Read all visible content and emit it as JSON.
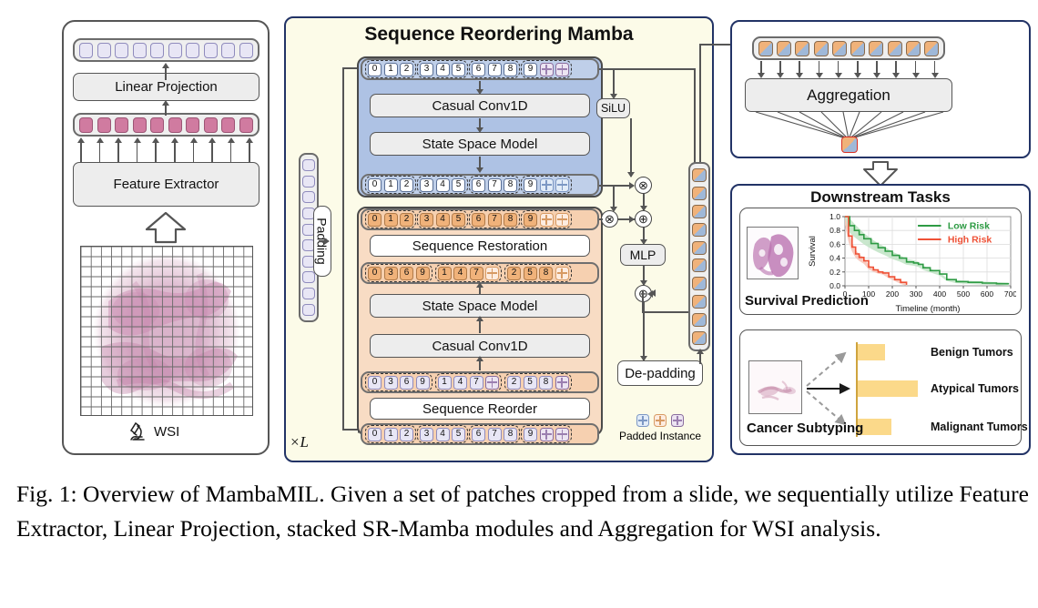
{
  "figure": {
    "caption": "Fig. 1: Overview of MambaMIL. Given a set of patches cropped from a slide, we sequentially utilize Feature Extractor, Linear Projection, stacked SR-Mamba modules and Aggregation for WSI analysis."
  },
  "left_panel": {
    "linear_projection_label": "Linear Projection",
    "feature_extractor_label": "Feature Extractor",
    "wsi_label": "WSI",
    "wsi_icon": "microscope-icon",
    "projected_token_count": 10,
    "feature_token_count": 10,
    "projected_token_color": "#e8e6f5",
    "feature_token_color": "#d07ba0"
  },
  "center_panel": {
    "title": "Sequence Reordering Mamba",
    "padding_label": "Padding",
    "repeat_label": "×L",
    "padding_column_tiles": 10,
    "padding_column_color": "#e8e6f5",
    "output_column_tiles": 10,
    "legend": {
      "label": "Padded Instance",
      "variants": [
        "blue",
        "orange",
        "purple"
      ]
    },
    "blue_branch": {
      "background": "#aec2e4",
      "input_sequence": {
        "groups": [
          [
            "0",
            "1",
            "2"
          ],
          [
            "3",
            "4",
            "5"
          ],
          [
            "6",
            "7",
            "8"
          ],
          [
            "9",
            "pad",
            "pad"
          ]
        ],
        "pad_style": "purple",
        "strip_color": "#bfcfe9"
      },
      "blocks": [
        "Casual Conv1D",
        "State Space Model"
      ],
      "output_sequence": {
        "groups": [
          [
            "0",
            "1",
            "2"
          ],
          [
            "3",
            "4",
            "5"
          ],
          [
            "6",
            "7",
            "8"
          ],
          [
            "9",
            "pad",
            "pad"
          ]
        ],
        "pad_style": "blue",
        "strip_color": "#bfcfe9"
      }
    },
    "orange_branch": {
      "background": "#f8dcc4",
      "top_sequence": {
        "groups": [
          [
            "0",
            "1",
            "2"
          ],
          [
            "3",
            "4",
            "5"
          ],
          [
            "6",
            "7",
            "8"
          ],
          [
            "9",
            "pad",
            "pad"
          ]
        ],
        "pad_style": "orange",
        "cell_color": "#f0b27a"
      },
      "sequence_restoration_label": "Sequence Restoration",
      "restored_sequence": {
        "groups": [
          [
            "0",
            "3",
            "6",
            "9"
          ],
          [
            "1",
            "4",
            "7",
            "pad"
          ],
          [
            "2",
            "5",
            "8",
            "pad"
          ]
        ],
        "pad_style": "orange",
        "cell_color": "#f0b27a"
      },
      "blocks": [
        "State Space Model",
        "Casual Conv1D"
      ],
      "reordered_sequence": {
        "groups": [
          [
            "0",
            "3",
            "6",
            "9"
          ],
          [
            "1",
            "4",
            "7",
            "pad"
          ],
          [
            "2",
            "5",
            "8",
            "pad"
          ]
        ],
        "pad_style": "purple",
        "cell_color": "#e8e6f5"
      },
      "sequence_reorder_label": "Sequence Reorder",
      "bottom_sequence": {
        "groups": [
          [
            "0",
            "1",
            "2"
          ],
          [
            "3",
            "4",
            "5"
          ],
          [
            "6",
            "7",
            "8"
          ],
          [
            "9",
            "pad",
            "pad"
          ]
        ],
        "pad_style": "purple",
        "cell_color": "#e8e6f5"
      }
    },
    "operators": {
      "silu_label": "SiLU",
      "mlp_label": "MLP",
      "depadding_label": "De-padding",
      "multiply_symbol": "⊗",
      "add_symbol": "⊕"
    }
  },
  "aggregation_panel": {
    "title": "Aggregation",
    "input_token_count": 10,
    "output_token_highlight_color": "#d93025"
  },
  "downstream_panel": {
    "title": "Downstream Tasks",
    "survival": {
      "task_label": "Survival Prediction",
      "thumbnail": "tissue-slide-thumbnail"
    },
    "subtyping": {
      "task_label": "Cancer Subtyping",
      "thumbnail": "tissue-slide-thumbnail",
      "classes": [
        "Benign Tumors",
        "Atypical Tumors",
        "Malignant Tumors"
      ],
      "bar_color": "#fbd98a",
      "bar_values": [
        0.18,
        0.62,
        0.26
      ]
    }
  },
  "chart_data": [
    {
      "type": "line",
      "title": "",
      "xlabel": "Timeline (month)",
      "ylabel": "Survival",
      "xlim": [
        0,
        700
      ],
      "ylim": [
        0.0,
        1.0
      ],
      "xticks": [
        0,
        100,
        200,
        300,
        400,
        500,
        600,
        700
      ],
      "yticks": [
        0.0,
        0.2,
        0.4,
        0.6,
        0.8,
        1.0
      ],
      "grid": true,
      "legend_position": "upper right",
      "series": [
        {
          "name": "Low Risk",
          "color": "#2e9b44",
          "band_color": "#bfe3c4",
          "x": [
            0,
            20,
            40,
            60,
            80,
            110,
            140,
            170,
            200,
            230,
            260,
            290,
            310,
            330,
            360,
            400,
            430,
            470,
            520,
            580,
            640,
            690
          ],
          "y": [
            1.0,
            0.87,
            0.8,
            0.74,
            0.68,
            0.61,
            0.55,
            0.5,
            0.44,
            0.4,
            0.345,
            0.33,
            0.31,
            0.26,
            0.22,
            0.17,
            0.09,
            0.06,
            0.05,
            0.04,
            0.03,
            0.02
          ]
        },
        {
          "name": "High Risk",
          "color": "#ef5136",
          "band_color": "#f7c3b6",
          "x": [
            0,
            15,
            30,
            45,
            60,
            80,
            100,
            120,
            140,
            160,
            185,
            210,
            235,
            260
          ],
          "y": [
            1.0,
            0.72,
            0.56,
            0.46,
            0.41,
            0.36,
            0.27,
            0.23,
            0.2,
            0.185,
            0.13,
            0.09,
            0.05,
            0.015
          ]
        }
      ]
    },
    {
      "type": "bar",
      "orientation": "horizontal",
      "title": "",
      "categories": [
        "Benign Tumors",
        "Atypical Tumors",
        "Malignant Tumors"
      ],
      "values": [
        0.18,
        0.62,
        0.26
      ],
      "xlabel": "",
      "ylabel": "",
      "bar_color": "#fbd98a"
    }
  ]
}
